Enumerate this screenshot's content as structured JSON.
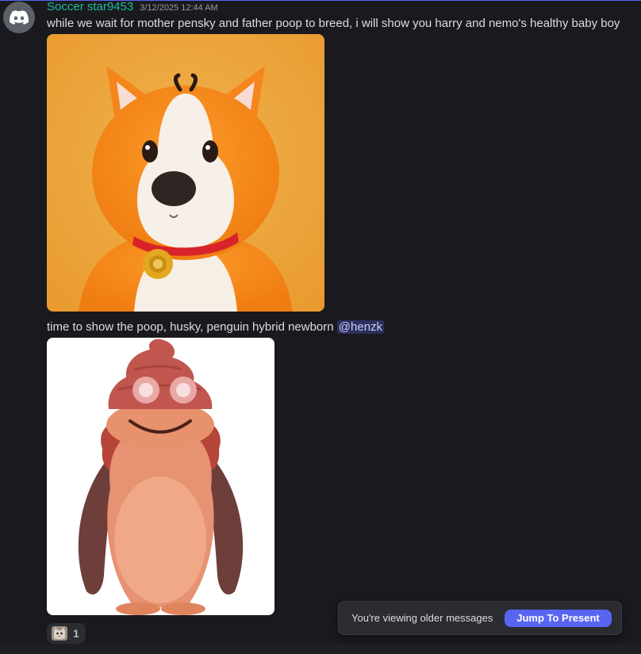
{
  "message": {
    "username": "Soccer star9453",
    "timestamp": "3/12/2025 12:44 AM",
    "text1": "while we wait for mother pensky and father poop to breed, i will show you harry and nemo's healthy baby boy",
    "text2_prefix": "time to show the poop, husky, penguin hybrid newborn ",
    "mention": "@henzk",
    "avatar_icon": "discord-logo-icon",
    "attachment1_icon": "corgi-dog-image",
    "attachment2_icon": "poop-penguin-hybrid-image"
  },
  "reaction": {
    "emoji_icon": "cat-emoji-icon",
    "count": "1"
  },
  "older_messages_bar": {
    "label": "You're viewing older messages",
    "button": "Jump To Present"
  },
  "colors": {
    "username": "#1abc9c",
    "accent": "#5865f2",
    "background": "#1a1a1e"
  }
}
